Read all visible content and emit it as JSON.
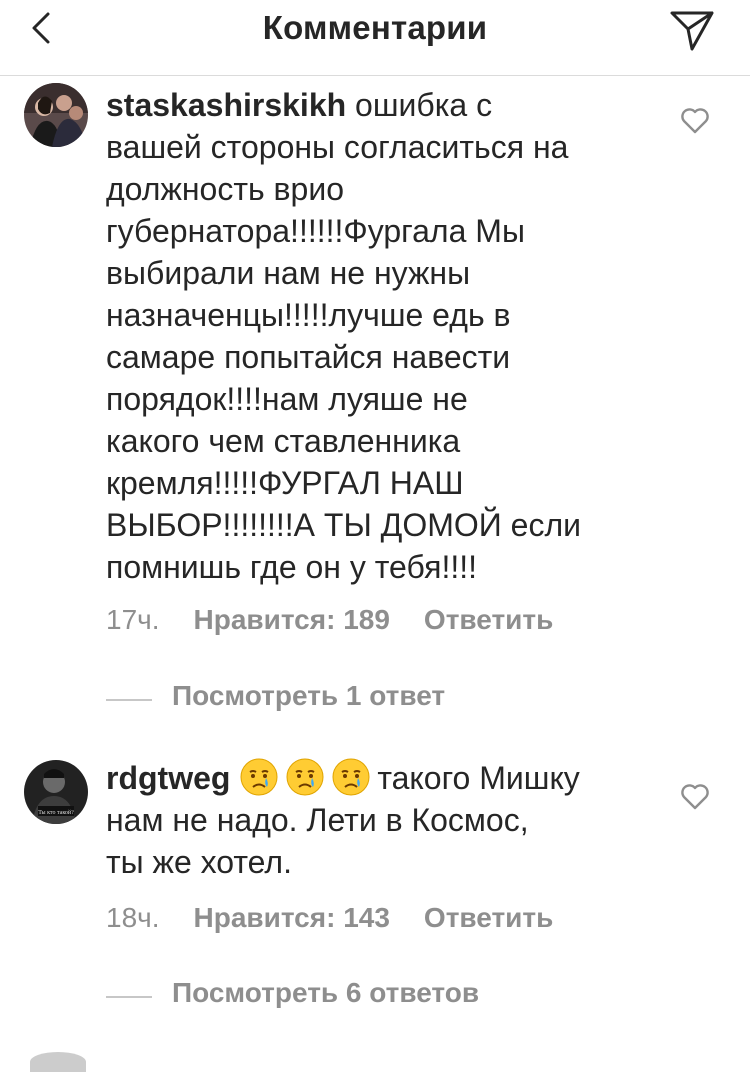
{
  "header": {
    "title": "Комментарии",
    "back_icon": "chevron-left-icon",
    "send_icon": "paper-plane-icon"
  },
  "comments": [
    {
      "username": "staskashirskikh",
      "text_lines": [
        "ошибка с",
        "вашей стороны согласиться на",
        "должность врио",
        "губернатора!!!!!!Фургала Мы",
        "выбирали нам не нужны",
        "назначенцы!!!!!лучше едь в",
        "самаре попытайся навести",
        "порядок!!!!нам луяше не",
        "какого чем ставленника",
        "кремля!!!!!ФУРГАЛ НАШ",
        "ВЫБОР!!!!!!!!А ТЫ ДОМОЙ если",
        "помнишь где он у тебя!!!!"
      ],
      "time": "17ч.",
      "likes": "Нравится: 189",
      "reply": "Ответить",
      "view_replies": "Посмотреть 1 ответ"
    },
    {
      "username": "rdgtweg",
      "emoji": [
        "crying-face-emoji",
        "crying-face-emoji",
        "crying-face-emoji"
      ],
      "text_lines": [
        "такого Мишку",
        "нам не надо. Лети в Космос,",
        "ты же хотел."
      ],
      "time": "18ч.",
      "likes": "Нравится: 143",
      "reply": "Ответить",
      "view_replies": "Посмотреть 6 ответов"
    }
  ],
  "colors": {
    "text": "#262626",
    "secondary": "#8e8e8e",
    "divider": "#dbdbdb"
  }
}
